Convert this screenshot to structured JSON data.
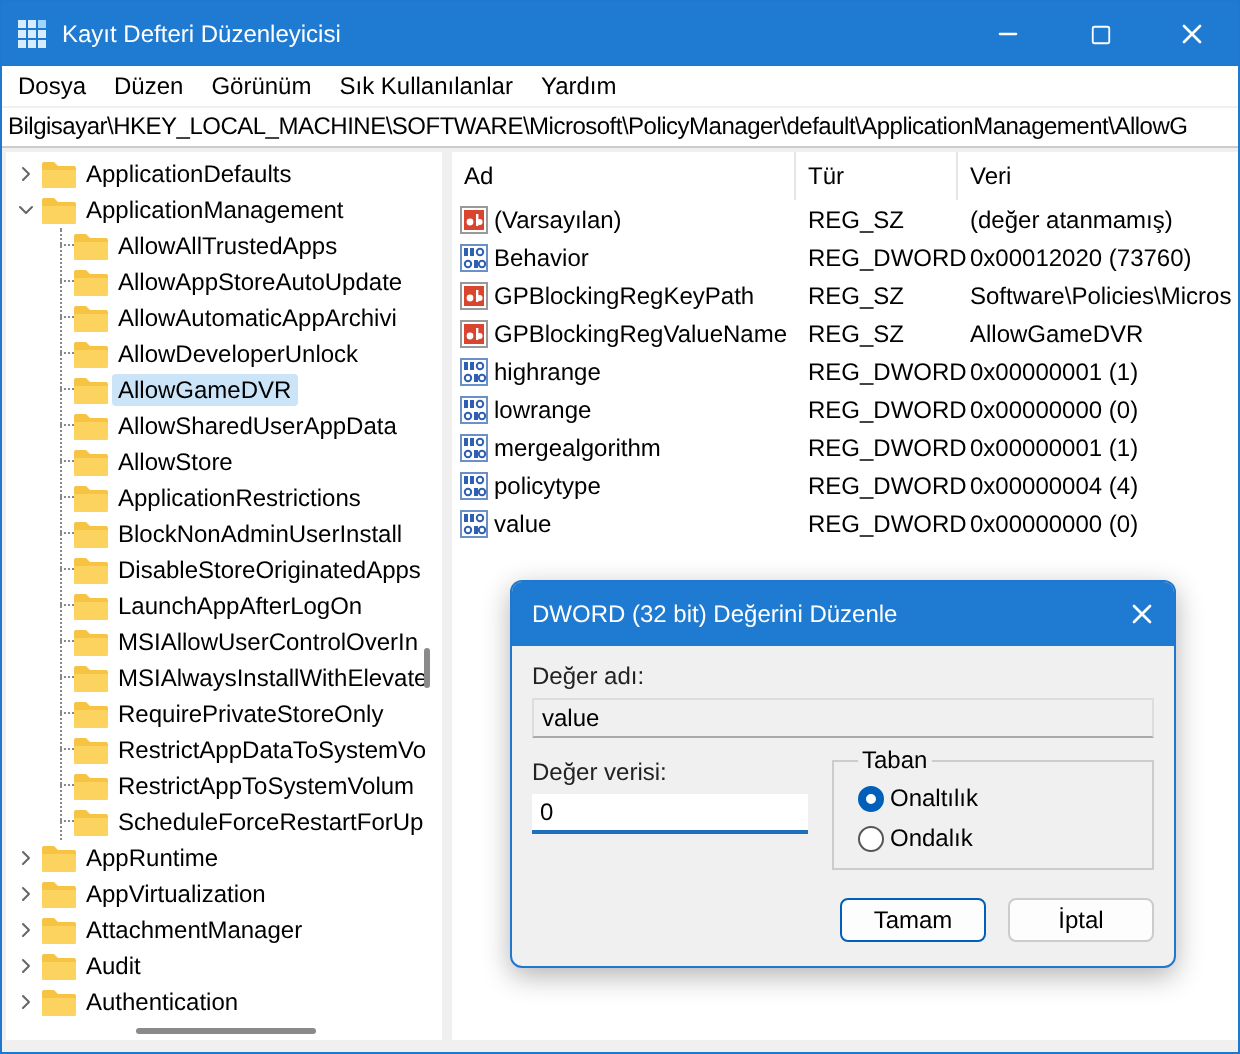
{
  "window": {
    "title": "Kayıt Defteri Düzenleyicisi"
  },
  "menu": [
    "Dosya",
    "Düzen",
    "Görünüm",
    "Sık Kullanılanlar",
    "Yardım"
  ],
  "address": "Bilgisayar\\HKEY_LOCAL_MACHINE\\SOFTWARE\\Microsoft\\PolicyManager\\default\\ApplicationManagement\\AllowG",
  "tree": [
    {
      "label": "ApplicationDefaults",
      "expanded": false,
      "selected": false
    },
    {
      "label": "ApplicationManagement",
      "expanded": true,
      "selected": false,
      "children": [
        {
          "label": "AllowAllTrustedApps",
          "selected": false
        },
        {
          "label": "AllowAppStoreAutoUpdate",
          "selected": false
        },
        {
          "label": "AllowAutomaticAppArchivi",
          "selected": false
        },
        {
          "label": "AllowDeveloperUnlock",
          "selected": false
        },
        {
          "label": "AllowGameDVR",
          "selected": true
        },
        {
          "label": "AllowSharedUserAppData",
          "selected": false
        },
        {
          "label": "AllowStore",
          "selected": false
        },
        {
          "label": "ApplicationRestrictions",
          "selected": false
        },
        {
          "label": "BlockNonAdminUserInstall",
          "selected": false
        },
        {
          "label": "DisableStoreOriginatedApps",
          "selected": false
        },
        {
          "label": "LaunchAppAfterLogOn",
          "selected": false
        },
        {
          "label": "MSIAllowUserControlOverIn",
          "selected": false
        },
        {
          "label": "MSIAlwaysInstallWithElevate",
          "selected": false
        },
        {
          "label": "RequirePrivateStoreOnly",
          "selected": false
        },
        {
          "label": "RestrictAppDataToSystemVo",
          "selected": false
        },
        {
          "label": "RestrictAppToSystemVolum",
          "selected": false
        },
        {
          "label": "ScheduleForceRestartForUp",
          "selected": false
        }
      ]
    },
    {
      "label": "AppRuntime",
      "expanded": false,
      "selected": false
    },
    {
      "label": "AppVirtualization",
      "expanded": false,
      "selected": false
    },
    {
      "label": "AttachmentManager",
      "expanded": false,
      "selected": false
    },
    {
      "label": "Audit",
      "expanded": false,
      "selected": false
    },
    {
      "label": "Authentication",
      "expanded": false,
      "selected": false
    }
  ],
  "values": {
    "columns": [
      "Ad",
      "Tür",
      "Veri"
    ],
    "rows": [
      {
        "kind": "string",
        "name": "(Varsayılan)",
        "type": "REG_SZ",
        "data": "(değer atanmamış)"
      },
      {
        "kind": "dword",
        "name": "Behavior",
        "type": "REG_DWORD",
        "data": "0x00012020 (73760)"
      },
      {
        "kind": "string",
        "name": "GPBlockingRegKeyPath",
        "type": "REG_SZ",
        "data": "Software\\Policies\\Micros"
      },
      {
        "kind": "string",
        "name": "GPBlockingRegValueName",
        "type": "REG_SZ",
        "data": "AllowGameDVR"
      },
      {
        "kind": "dword",
        "name": "highrange",
        "type": "REG_DWORD",
        "data": "0x00000001 (1)"
      },
      {
        "kind": "dword",
        "name": "lowrange",
        "type": "REG_DWORD",
        "data": "0x00000000 (0)"
      },
      {
        "kind": "dword",
        "name": "mergealgorithm",
        "type": "REG_DWORD",
        "data": "0x00000001 (1)"
      },
      {
        "kind": "dword",
        "name": "policytype",
        "type": "REG_DWORD",
        "data": "0x00000004 (4)"
      },
      {
        "kind": "dword",
        "name": "value",
        "type": "REG_DWORD",
        "data": "0x00000000 (0)"
      }
    ]
  },
  "dialog": {
    "title": "DWORD (32 bit) Değerini Düzenle",
    "name_label": "Değer adı:",
    "name_value": "value",
    "data_label": "Değer verisi:",
    "data_value": "0",
    "base_label": "Taban",
    "base_options": [
      {
        "label": "Onaltılık",
        "selected": true
      },
      {
        "label": "Ondalık",
        "selected": false
      }
    ],
    "buttons": [
      {
        "label": "Tamam",
        "default": true
      },
      {
        "label": "İptal",
        "default": false
      }
    ]
  }
}
